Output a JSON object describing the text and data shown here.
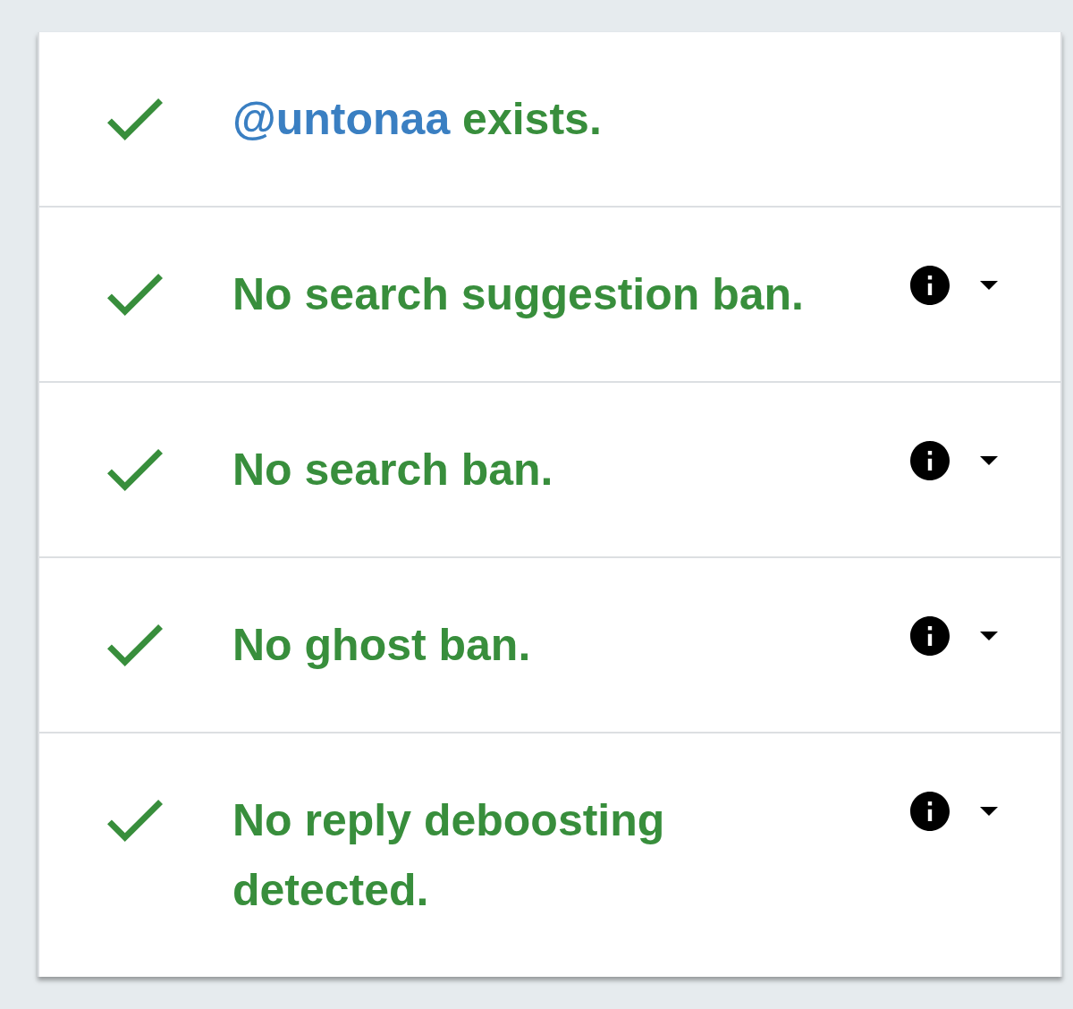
{
  "results": [
    {
      "kind": "plain",
      "passed": true,
      "handle": "@untonaa",
      "text": "exists."
    },
    {
      "kind": "expandable",
      "passed": true,
      "text": "No search suggestion ban.",
      "expanded": false
    },
    {
      "kind": "expandable",
      "passed": true,
      "text": "No search ban.",
      "expanded": false
    },
    {
      "kind": "expandable",
      "passed": true,
      "text": "No ghost ban.",
      "expanded": false
    },
    {
      "kind": "expandable",
      "passed": true,
      "text": "No reply deboosting detected.",
      "expanded": false
    }
  ]
}
